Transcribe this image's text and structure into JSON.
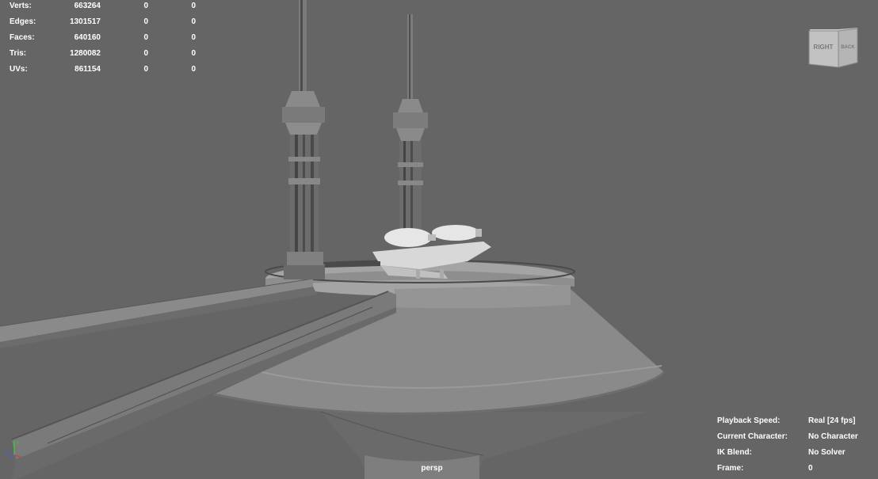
{
  "stats": [
    {
      "label": "Verts:",
      "value": "663264",
      "c2": "0",
      "c3": "0"
    },
    {
      "label": "Edges:",
      "value": "1301517",
      "c2": "0",
      "c3": "0"
    },
    {
      "label": "Faces:",
      "value": "640160",
      "c2": "0",
      "c3": "0"
    },
    {
      "label": "Tris:",
      "value": "1280082",
      "c2": "0",
      "c3": "0"
    },
    {
      "label": "UVs:",
      "value": "861154",
      "c2": "0",
      "c3": "0"
    }
  ],
  "hud": {
    "playback_label": "Playback Speed:",
    "playback_value": "Real [24 fps]",
    "character_label": "Current Character:",
    "character_value": "No Character",
    "ik_label": "IK Blend:",
    "ik_value": "No Solver",
    "frame_label": "Frame:",
    "frame_value": "0"
  },
  "camera": "persp",
  "viewcube": {
    "face_front": "RIGHT",
    "face_side": "BACK"
  },
  "axis": {
    "y": "Y",
    "z": "Z"
  },
  "colors": {
    "background": "#656565",
    "text": "#ffffff",
    "gizmo_x": "#d04040",
    "gizmo_y": "#40c040",
    "gizmo_z": "#4060e0"
  }
}
